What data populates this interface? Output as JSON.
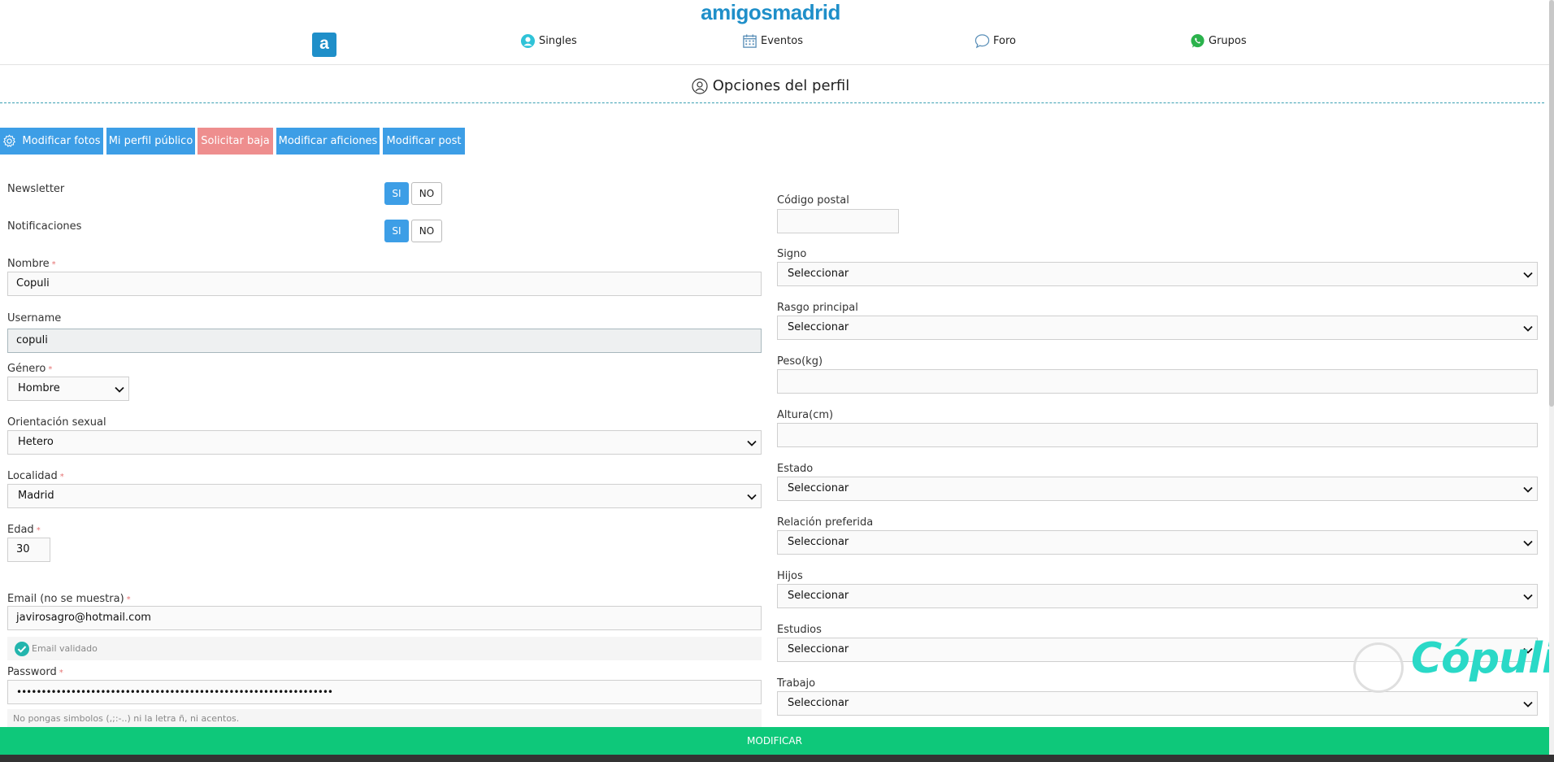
{
  "header": {
    "site_name": "amigosmadrid",
    "badge_letter": "a",
    "nav": [
      {
        "label": "Singles",
        "icon": "user-circle-icon"
      },
      {
        "label": "Eventos",
        "icon": "calendar-icon"
      },
      {
        "label": "Foro",
        "icon": "chat-bubble-icon"
      },
      {
        "label": "Grupos",
        "icon": "whatsapp-icon"
      }
    ]
  },
  "page": {
    "title": "Opciones del perfil"
  },
  "actions": [
    {
      "label": "Modificar fotos",
      "icon": "gear-icon"
    },
    {
      "label": "Mi perfil público"
    },
    {
      "label": "Solicitar baja"
    },
    {
      "label": "Modificar aficiones"
    },
    {
      "label": "Modificar post"
    }
  ],
  "left": {
    "newsletter": {
      "label": "Newsletter",
      "yes": "SI",
      "no": "NO",
      "selected": "SI"
    },
    "notificaciones": {
      "label": "Notificaciones",
      "yes": "SI",
      "no": "NO",
      "selected": "SI"
    },
    "nombre": {
      "label": "Nombre",
      "value": "Copuli"
    },
    "username": {
      "label": "Username",
      "value": "copuli"
    },
    "genero": {
      "label": "Género",
      "value": "Hombre"
    },
    "orientacion": {
      "label": "Orientación sexual",
      "value": "Hetero"
    },
    "localidad": {
      "label": "Localidad",
      "value": "Madrid"
    },
    "edad": {
      "label": "Edad",
      "value": "30"
    },
    "email": {
      "label": "Email (no se muestra)",
      "value": "javirosagro@hotmail.com",
      "validated": "Email validado"
    },
    "password": {
      "label": "Password",
      "value": "••••••••••••••••••••••••••••••••••••••••••••••••••••••••••••••••",
      "hint": "No pongas simbolos (,;:-..) ni la letra ñ, ni acentos."
    },
    "required_mark": "*"
  },
  "right": {
    "codigo_postal": {
      "label": "Código postal",
      "value": ""
    },
    "signo": {
      "label": "Signo",
      "value": "Seleccionar"
    },
    "rasgo": {
      "label": "Rasgo principal",
      "value": "Seleccionar"
    },
    "peso": {
      "label": "Peso(kg)",
      "value": ""
    },
    "altura": {
      "label": "Altura(cm)",
      "value": ""
    },
    "estado": {
      "label": "Estado",
      "value": "Seleccionar"
    },
    "relacion": {
      "label": "Relación preferida",
      "value": "Seleccionar"
    },
    "hijos": {
      "label": "Hijos",
      "value": "Seleccionar"
    },
    "estudios": {
      "label": "Estudios",
      "value": "Seleccionar"
    },
    "trabajo": {
      "label": "Trabajo",
      "value": "Seleccionar"
    }
  },
  "footer": {
    "submit_label": "MODIFICAR"
  },
  "watermark": "Cópuli",
  "colors": {
    "brand": "#1f8fc9",
    "action_blue": "#3d9ee6",
    "danger": "#ee8e8e",
    "submit": "#0ec87a",
    "watermark": "#2ad9c7"
  }
}
